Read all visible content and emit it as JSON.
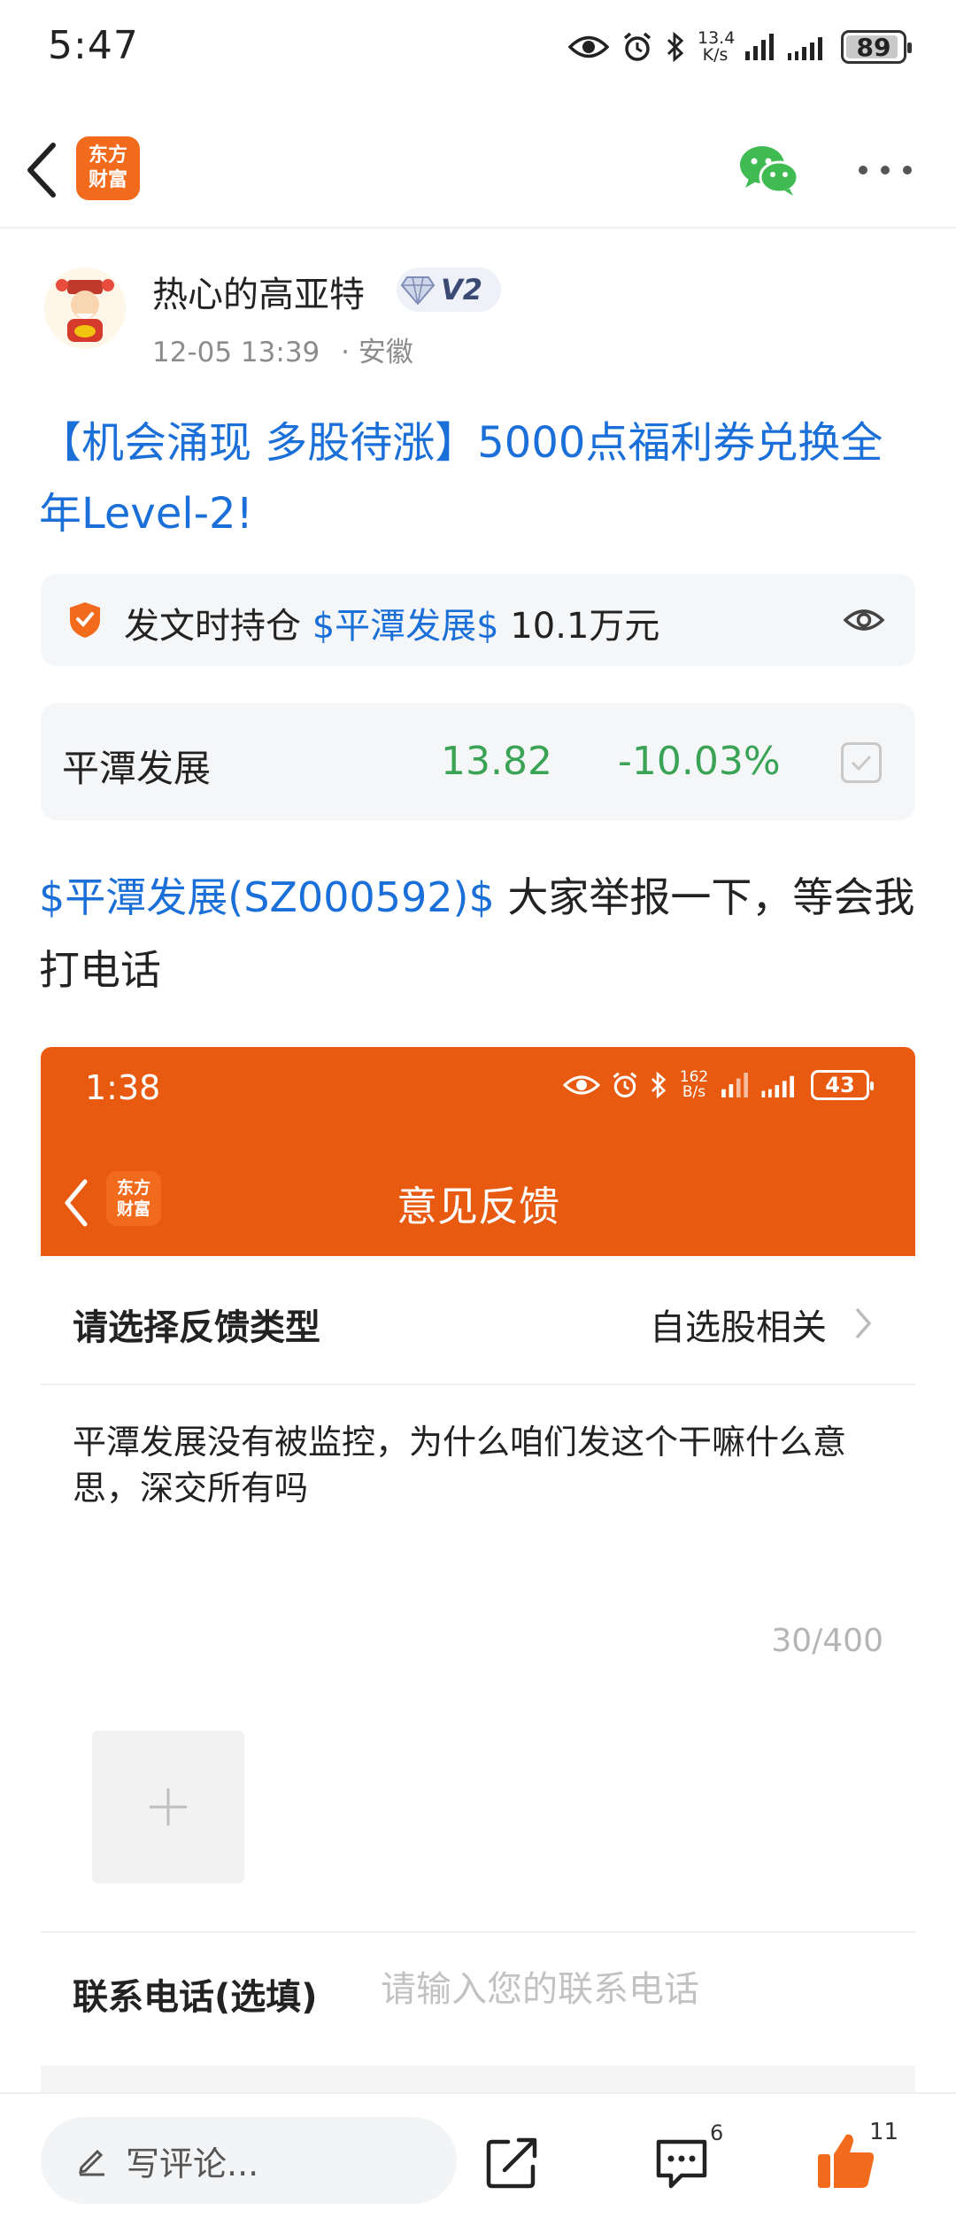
{
  "status_bar": {
    "time": "5:47",
    "net_speed_value": "13.4",
    "net_speed_unit": "K/s",
    "battery": "89"
  },
  "nav": {
    "brand_logo_line1": "东方",
    "brand_logo_line2": "财富"
  },
  "author": {
    "name": "热心的高亚特",
    "level": "V2",
    "date": "12-05 13:39",
    "location": "· 安徽"
  },
  "post": {
    "title": "【机会涌现 多股待涨】5000点福利券兑换全年Level-2!",
    "holding_prefix": "发文时持仓",
    "holding_stock": "$平潭发展$",
    "holding_amount": "10.1万元",
    "body_stock_link": "$平潭发展(SZ000592)$",
    "body_text": " 大家举报一下，等会我打电话"
  },
  "quote": {
    "name": "平潭发展",
    "price": "13.82",
    "change": "-10.03%",
    "color": "#3aa356"
  },
  "embedded_screenshot": {
    "time": "1:38",
    "net_speed_value": "162",
    "net_speed_unit": "B/s",
    "battery": "43",
    "logo_line1": "东方",
    "logo_line2": "财富",
    "title": "意见反馈",
    "header_color": "#e85a10",
    "feedback_type_label": "请选择反馈类型",
    "feedback_type_value": "自选股相关",
    "feedback_text": "平潭发展没有被监控，为什么咱们发这个干嘛什么意思，深交所有吗",
    "char_counter": "30/400",
    "phone_label": "联系电话(选填)",
    "phone_placeholder": "请输入您的联系电话"
  },
  "bottom_bar": {
    "comment_placeholder": "写评论...",
    "comment_count": "6",
    "like_count": "11",
    "accent_color": "#f26a1b"
  }
}
